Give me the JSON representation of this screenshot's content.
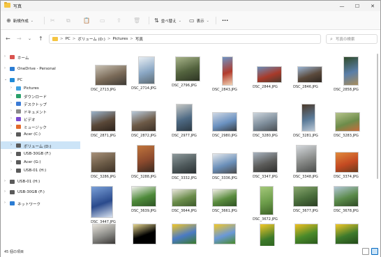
{
  "window": {
    "title": "写真"
  },
  "toolbar": {
    "new_label": "新規作成",
    "sort_label": "並べ替え",
    "view_label": "表示",
    "more_label": "···"
  },
  "address": {
    "crumbs": [
      "PC",
      "ボリューム (D:)",
      "Pictures",
      "写真"
    ],
    "separator": ">"
  },
  "search": {
    "placeholder": "写真の検索"
  },
  "sidebar": {
    "items": [
      {
        "label": "ホーム",
        "color": "#d9534f",
        "depth": 0,
        "arrow": ">"
      },
      {
        "label": "OneDrive - Personal",
        "color": "#2b7cd3",
        "depth": 0,
        "arrow": ">"
      },
      {
        "label": "PC",
        "color": "#1f8ad8",
        "depth": 0,
        "arrow": "v"
      },
      {
        "label": "Pictures",
        "color": "#3ea0e0",
        "depth": 1,
        "arrow": ">"
      },
      {
        "label": "ダウンロード",
        "color": "#2aa06a",
        "depth": 1,
        "arrow": ">"
      },
      {
        "label": "デスクトップ",
        "color": "#3b7bd6",
        "depth": 1,
        "arrow": ">"
      },
      {
        "label": "ドキュメント",
        "color": "#8a8a8a",
        "depth": 1,
        "arrow": ">"
      },
      {
        "label": "ビデオ",
        "color": "#7b4bd0",
        "depth": 1,
        "arrow": ">"
      },
      {
        "label": "ミュージック",
        "color": "#e26a2c",
        "depth": 1,
        "arrow": ">"
      },
      {
        "label": "Acer (C:)",
        "color": "#5a5a5a",
        "depth": 1,
        "arrow": ">"
      },
      {
        "label": "ボリューム (D:)",
        "color": "#5a5a5a",
        "depth": 1,
        "arrow": ">",
        "selected": true
      },
      {
        "label": "USB-30GB (F:)",
        "color": "#5a5a5a",
        "depth": 1,
        "arrow": ">"
      },
      {
        "label": "Acer (G:)",
        "color": "#5a5a5a",
        "depth": 1,
        "arrow": ">"
      },
      {
        "label": "USB-01 (H:)",
        "color": "#5a5a5a",
        "depth": 1,
        "arrow": ">"
      },
      {
        "label": "USB-01 (H:)",
        "color": "#5a5a5a",
        "depth": 0,
        "arrow": ">"
      },
      {
        "label": "USB-30GB (F:)",
        "color": "#5a5a5a",
        "depth": 0,
        "arrow": ">"
      },
      {
        "label": "ネットワーク",
        "color": "#2b7cd3",
        "depth": 0,
        "arrow": ">"
      }
    ]
  },
  "files": [
    {
      "name": "DSC_2713.JPG",
      "colors": [
        "#7a6a58",
        "#c9c2b4",
        "#3e3a34"
      ]
    },
    {
      "name": "DSC_2714.JPG",
      "colors": [
        "#8aa7c4",
        "#e8eef3",
        "#5d6b73"
      ]
    },
    {
      "name": "DSC_2796.JPG",
      "colors": [
        "#53633e",
        "#a8b48a",
        "#2e3524"
      ]
    },
    {
      "name": "DSC_2843.JPG",
      "colors": [
        "#b23b2c",
        "#6c93c4",
        "#f1d2b4"
      ]
    },
    {
      "name": "DSC_2844.JPG",
      "colors": [
        "#a83a2a",
        "#6a8cb8",
        "#4a3a2e"
      ]
    },
    {
      "name": "DSC_2846.JPG",
      "colors": [
        "#5b4a3c",
        "#9bb6d6",
        "#2d2620"
      ]
    },
    {
      "name": "DSC_2858.JPG",
      "colors": [
        "#5a7ea8",
        "#2f4a2a",
        "#a78c5c"
      ]
    },
    {
      "name": "DSC_2871.JPG",
      "colors": [
        "#5a4838",
        "#9cb4cc",
        "#2c231c"
      ]
    },
    {
      "name": "DSC_2872.JPG",
      "colors": [
        "#6d5a47",
        "#b9cadb",
        "#3c3128"
      ]
    },
    {
      "name": "DSC_2977.JPG",
      "colors": [
        "#4e6a84",
        "#c5c7c4",
        "#2d3a44"
      ]
    },
    {
      "name": "DSC_2980.JPG",
      "colors": [
        "#6a91c0",
        "#cfd8e4",
        "#3a3f45"
      ]
    },
    {
      "name": "DSC_3280.JPG",
      "colors": [
        "#7d8c99",
        "#cdd6de",
        "#4a4e52"
      ]
    },
    {
      "name": "DSC_3281.JPG",
      "colors": [
        "#5a7a98",
        "#4c3a2a",
        "#bbc8d6"
      ]
    },
    {
      "name": "DSC_3283.JPG",
      "colors": [
        "#6d8c4a",
        "#b6c48c",
        "#c86a3a"
      ]
    },
    {
      "name": "DSC_3286.JPG",
      "colors": [
        "#6a5a46",
        "#a8917a",
        "#3d3126"
      ]
    },
    {
      "name": "DSC_3288.JPG",
      "colors": [
        "#8c4a2e",
        "#c0753c",
        "#3a2a20"
      ]
    },
    {
      "name": "DSC_3332.JPG",
      "colors": [
        "#4f5a5c",
        "#8e9a9c",
        "#2a3032"
      ]
    },
    {
      "name": "DSC_3336.JPG",
      "colors": [
        "#6a8fb9",
        "#e4e8ec",
        "#4a4a4a"
      ]
    },
    {
      "name": "DSC_3347.JPG",
      "colors": [
        "#5c5c5a",
        "#a9b4c0",
        "#2e2e2c"
      ]
    },
    {
      "name": "DSC_3348.JPG",
      "colors": [
        "#888a88",
        "#d4d8dc",
        "#4a4c4a"
      ]
    },
    {
      "name": "DSC_3374.JPG",
      "colors": [
        "#c44a22",
        "#e08a3c",
        "#6a3a1c"
      ]
    },
    {
      "name": "DSC_3447.JPG",
      "colors": [
        "#2a4a8c",
        "#7aa0d8",
        "#d8e2f0"
      ]
    },
    {
      "name": "DSC_3639.JPG",
      "colors": [
        "#4e8a3a",
        "#f0f0ec",
        "#2d5424"
      ]
    },
    {
      "name": "DSC_3644.JPG",
      "colors": [
        "#6a8c4a",
        "#eae6dc",
        "#3d5a2a"
      ]
    },
    {
      "name": "DSC_3661.JPG",
      "colors": [
        "#5a8c3e",
        "#f2eee6",
        "#2e5222"
      ]
    },
    {
      "name": "DSC_3672.JPG",
      "colors": [
        "#6c9c4a",
        "#a4c87a",
        "#3e6428"
      ]
    },
    {
      "name": "DSC_3677.JPG",
      "colors": [
        "#4a6e3c",
        "#8aa870",
        "#2a3e22"
      ]
    },
    {
      "name": "DSC_3678.JPG",
      "colors": [
        "#5a8a4a",
        "#b4c8d8",
        "#2e4a24"
      ]
    },
    {
      "name": "",
      "colors": [
        "#8a8a86",
        "#e8e4dc",
        "#3a3836"
      ]
    },
    {
      "name": "",
      "colors": [
        "#000000",
        "#e8d890",
        "#000000"
      ]
    },
    {
      "name": "",
      "colors": [
        "#4a7ac4",
        "#f2c828",
        "#3c7a2a"
      ]
    },
    {
      "name": "",
      "colors": [
        "#6a98d8",
        "#f2c828",
        "#4a8a2a"
      ]
    },
    {
      "name": "",
      "colors": [
        "#3c7a2a",
        "#f2c828",
        "#2a5a1c"
      ]
    },
    {
      "name": "",
      "colors": [
        "#4a8a2a",
        "#f0c020",
        "#2a5a1c"
      ]
    },
    {
      "name": "",
      "colors": [
        "#3e7a2c",
        "#f2c828",
        "#224a18"
      ]
    }
  ],
  "status": {
    "count_text": "45 個の項目"
  }
}
